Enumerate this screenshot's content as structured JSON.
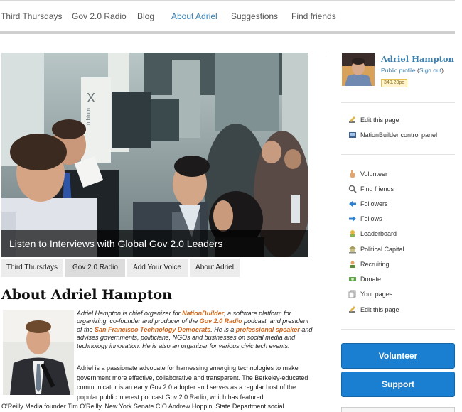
{
  "topnav": [
    {
      "label": "Third Thursdays",
      "active": false
    },
    {
      "label": "Gov 2.0 Radio",
      "active": false
    },
    {
      "label": "Blog",
      "active": false
    },
    {
      "label": "About Adriel",
      "active": true
    },
    {
      "label": "Suggestions",
      "active": false
    },
    {
      "label": "Find friends",
      "active": false
    }
  ],
  "hero": {
    "caption": "Listen to Interviews with Global Gov 2.0 Leaders",
    "sign_text": "nthium"
  },
  "tabs": [
    {
      "label": "Third Thursdays",
      "active": false
    },
    {
      "label": "Gov 2.0 Radio",
      "active": true
    },
    {
      "label": "Add Your Voice",
      "active": false
    },
    {
      "label": "About Adriel",
      "active": false
    }
  ],
  "article": {
    "title": "About Adriel Hampton",
    "intro": {
      "t1": "Adriel Hampton is chief organizer for ",
      "link1": "NationBuilder",
      "t2": ", a software platform for organizing, co-founder and producer of the ",
      "link2": "Gov 2.0 Radio",
      "t3": " podcast, and president of the ",
      "link3": "San Francisco Technology Democrats",
      "t4": ". He is a ",
      "link4": "professional speaker",
      "t5": " and advises governments, politicians, NGOs and businesses on social media and technology innovation. He is also an organizer for various civic tech events."
    },
    "para2": "Adriel is a passionate advocate for harnessing emerging technologies to make government more effective, collaborative and transparent. The Berkeley-educated communicator is an early Gov 2.0 adopter and serves as a regular host of the popular public interest podcast Gov 2.0 Radio, which has featured",
    "para3": "O'Reilly Media founder Tim O'Reilly, New York Senate CIO Andrew Hoppin, State Department social"
  },
  "user": {
    "name": "Adriel Hampton",
    "public_profile": "Public profile",
    "sign_out": "Sign out",
    "points": "340.20pc"
  },
  "admin_links": [
    {
      "label": "Edit this page",
      "icon": "pencil-icon"
    },
    {
      "label": "NationBuilder control panel",
      "icon": "control-panel-icon"
    }
  ],
  "nav_links": [
    {
      "label": "Volunteer",
      "icon": "hand-icon"
    },
    {
      "label": "Find friends",
      "icon": "magnifier-icon"
    },
    {
      "label": "Followers",
      "icon": "arrow-in-icon"
    },
    {
      "label": "Follows",
      "icon": "arrow-out-icon"
    },
    {
      "label": "Leaderboard",
      "icon": "trophy-icon"
    },
    {
      "label": "Political Capital",
      "icon": "capitol-icon"
    },
    {
      "label": "Recruiting",
      "icon": "recruit-icon"
    },
    {
      "label": "Donate",
      "icon": "money-icon"
    },
    {
      "label": "Your pages",
      "icon": "pages-icon"
    },
    {
      "label": "Edit this page",
      "icon": "pencil-icon"
    }
  ],
  "buttons": {
    "volunteer": "Volunteer",
    "support": "Support"
  },
  "colors": {
    "link": "#3a7fae",
    "accent_link": "#d0661c",
    "button": "#1a7fd0",
    "caption_bg": "#000000"
  }
}
